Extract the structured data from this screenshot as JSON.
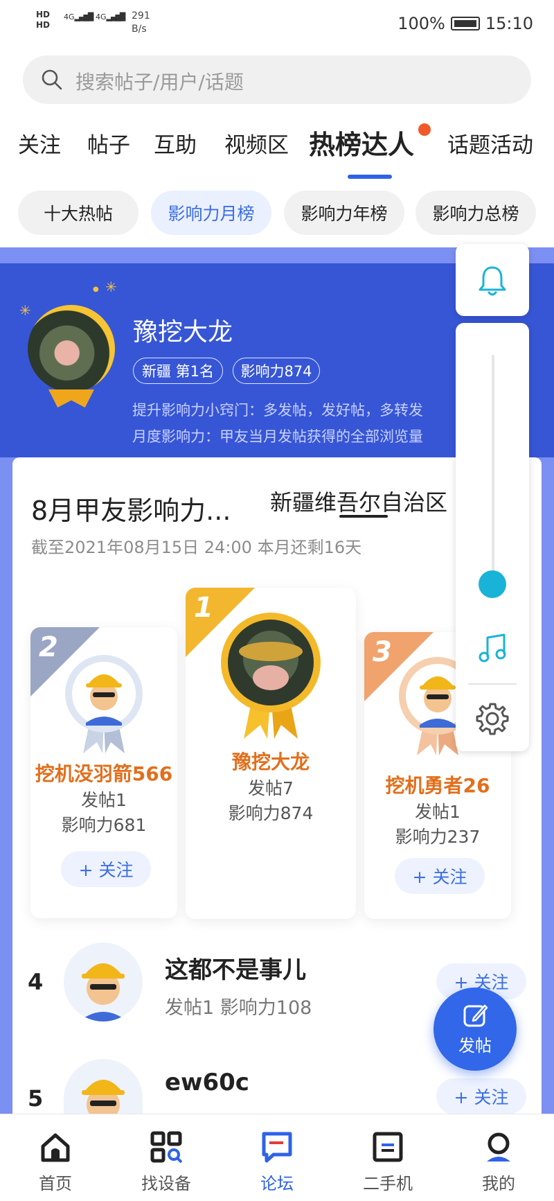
{
  "status_bar": {
    "hd1": "HD",
    "hd2": "HD",
    "signal1": "4G",
    "signal2": "4G",
    "speed_value": "291",
    "speed_unit": "B/s",
    "battery": "100%",
    "time": "15:10"
  },
  "search": {
    "placeholder": "搜索帖子/用户/话题"
  },
  "tabs": [
    {
      "label": "关注",
      "active": false
    },
    {
      "label": "帖子",
      "active": false
    },
    {
      "label": "互助",
      "active": false
    },
    {
      "label": "视频区",
      "active": false
    },
    {
      "label": "热榜达人",
      "active": true
    },
    {
      "label": "话题活动",
      "active": false
    }
  ],
  "sub_tabs": [
    {
      "label": "十大热帖",
      "active": false
    },
    {
      "label": "影响力月榜",
      "active": true
    },
    {
      "label": "影响力年榜",
      "active": false
    },
    {
      "label": "影响力总榜",
      "active": false
    }
  ],
  "banner": {
    "name": "豫挖大龙",
    "region_rank": "新疆  第1名",
    "influence": "影响力874",
    "tip": "提升影响力小窍门：多发帖，发好帖，多转发",
    "definition": "月度影响力：甲友当月发帖获得的全部浏览量"
  },
  "leaderboard": {
    "title": "8月甲友影响力...",
    "region": "新疆维吾尔自治区",
    "deadline": "截至2021年08月15日 24:00 本月还剩16天",
    "podium": [
      {
        "rank": "2",
        "name": "挖机没羽箭566",
        "posts": "发帖1",
        "influence": "影响力681",
        "follow": "+ 关注"
      },
      {
        "rank": "1",
        "name": "豫挖大龙",
        "posts": "发帖7",
        "influence": "影响力874"
      },
      {
        "rank": "3",
        "name": "挖机勇者26",
        "posts": "发帖1",
        "influence": "影响力237",
        "follow": "+ 关注"
      }
    ],
    "rows": [
      {
        "rank": "4",
        "name": "这都不是事儿",
        "stats": "发帖1    影响力108",
        "follow": "+ 关注"
      },
      {
        "rank": "5",
        "name": "ew60c",
        "stats": "",
        "follow": "+ 关注"
      }
    ]
  },
  "fab": {
    "label": "发帖"
  },
  "bottom_nav": [
    {
      "label": "首页",
      "icon": "home-icon",
      "active": false
    },
    {
      "label": "找设备",
      "icon": "grid-search-icon",
      "active": false
    },
    {
      "label": "论坛",
      "icon": "forum-icon",
      "active": true
    },
    {
      "label": "二手机",
      "icon": "used-machine-icon",
      "active": false
    },
    {
      "label": "我的",
      "icon": "profile-icon",
      "active": false
    }
  ],
  "colors": {
    "accent": "#2f62e6",
    "banner": "#3756d6",
    "orange_name": "#e26f1c",
    "red_dot": "#f2592a",
    "teal": "#19b3d8"
  }
}
